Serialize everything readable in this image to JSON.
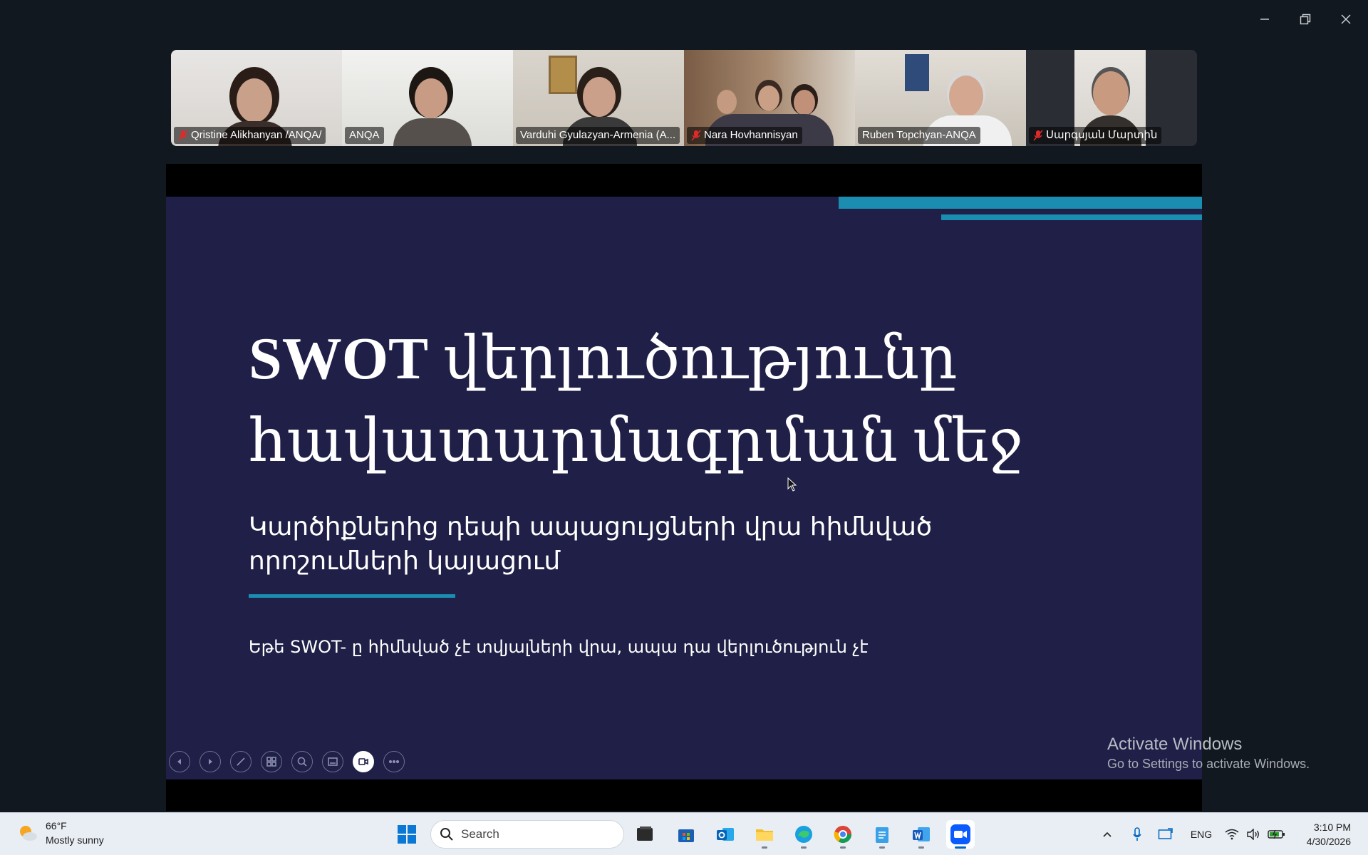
{
  "window": {
    "controls": [
      "minimize",
      "restore",
      "close"
    ]
  },
  "participants": [
    {
      "name": "Qristine Alikhanyan /ANQA/",
      "muted": true,
      "active": false
    },
    {
      "name": "ANQA",
      "muted": false,
      "active": true
    },
    {
      "name": "Varduhi Gyulazyan-Armenia (A...",
      "muted": false,
      "active": false
    },
    {
      "name": "Nara Hovhannisyan",
      "muted": true,
      "active": false
    },
    {
      "name": "Ruben Topchyan-ANQA",
      "muted": false,
      "active": false
    },
    {
      "name": "Սարգսյան Մարտին",
      "muted": true,
      "active": false
    }
  ],
  "slide": {
    "title_bold": "SWOT",
    "title_rest": " վերլուծությունը հավատարմագրման մեջ",
    "subtitle": "Կարծիքներից դեպի ապացույցների վրա հիմնված որոշումների կայացում",
    "note": "Եթե  SWOT- ը հիմնված չէ տվյալների վրա, ապա դա վերլուծություն չէ",
    "accent_color": "#1a8db0",
    "background_color": "#1f1f47"
  },
  "slide_toolbar": [
    "previous-slide",
    "next-slide",
    "pen",
    "see-all-slides",
    "zoom",
    "subtitles",
    "camera",
    "more-options"
  ],
  "watermark": {
    "line1": "Activate Windows",
    "line2": "Go to Settings to activate Windows."
  },
  "taskbar": {
    "weather_temp": "66°F",
    "weather_desc": "Mostly sunny",
    "search_placeholder": "Search",
    "apps": [
      "windows-start",
      "search",
      "file-explorer-dark",
      "microsoft-store",
      "outlook",
      "file-explorer",
      "edge",
      "chrome",
      "notepad",
      "word",
      "zoom"
    ],
    "language": "ENG",
    "time": "3:10 PM",
    "date": "4/30/2026"
  }
}
